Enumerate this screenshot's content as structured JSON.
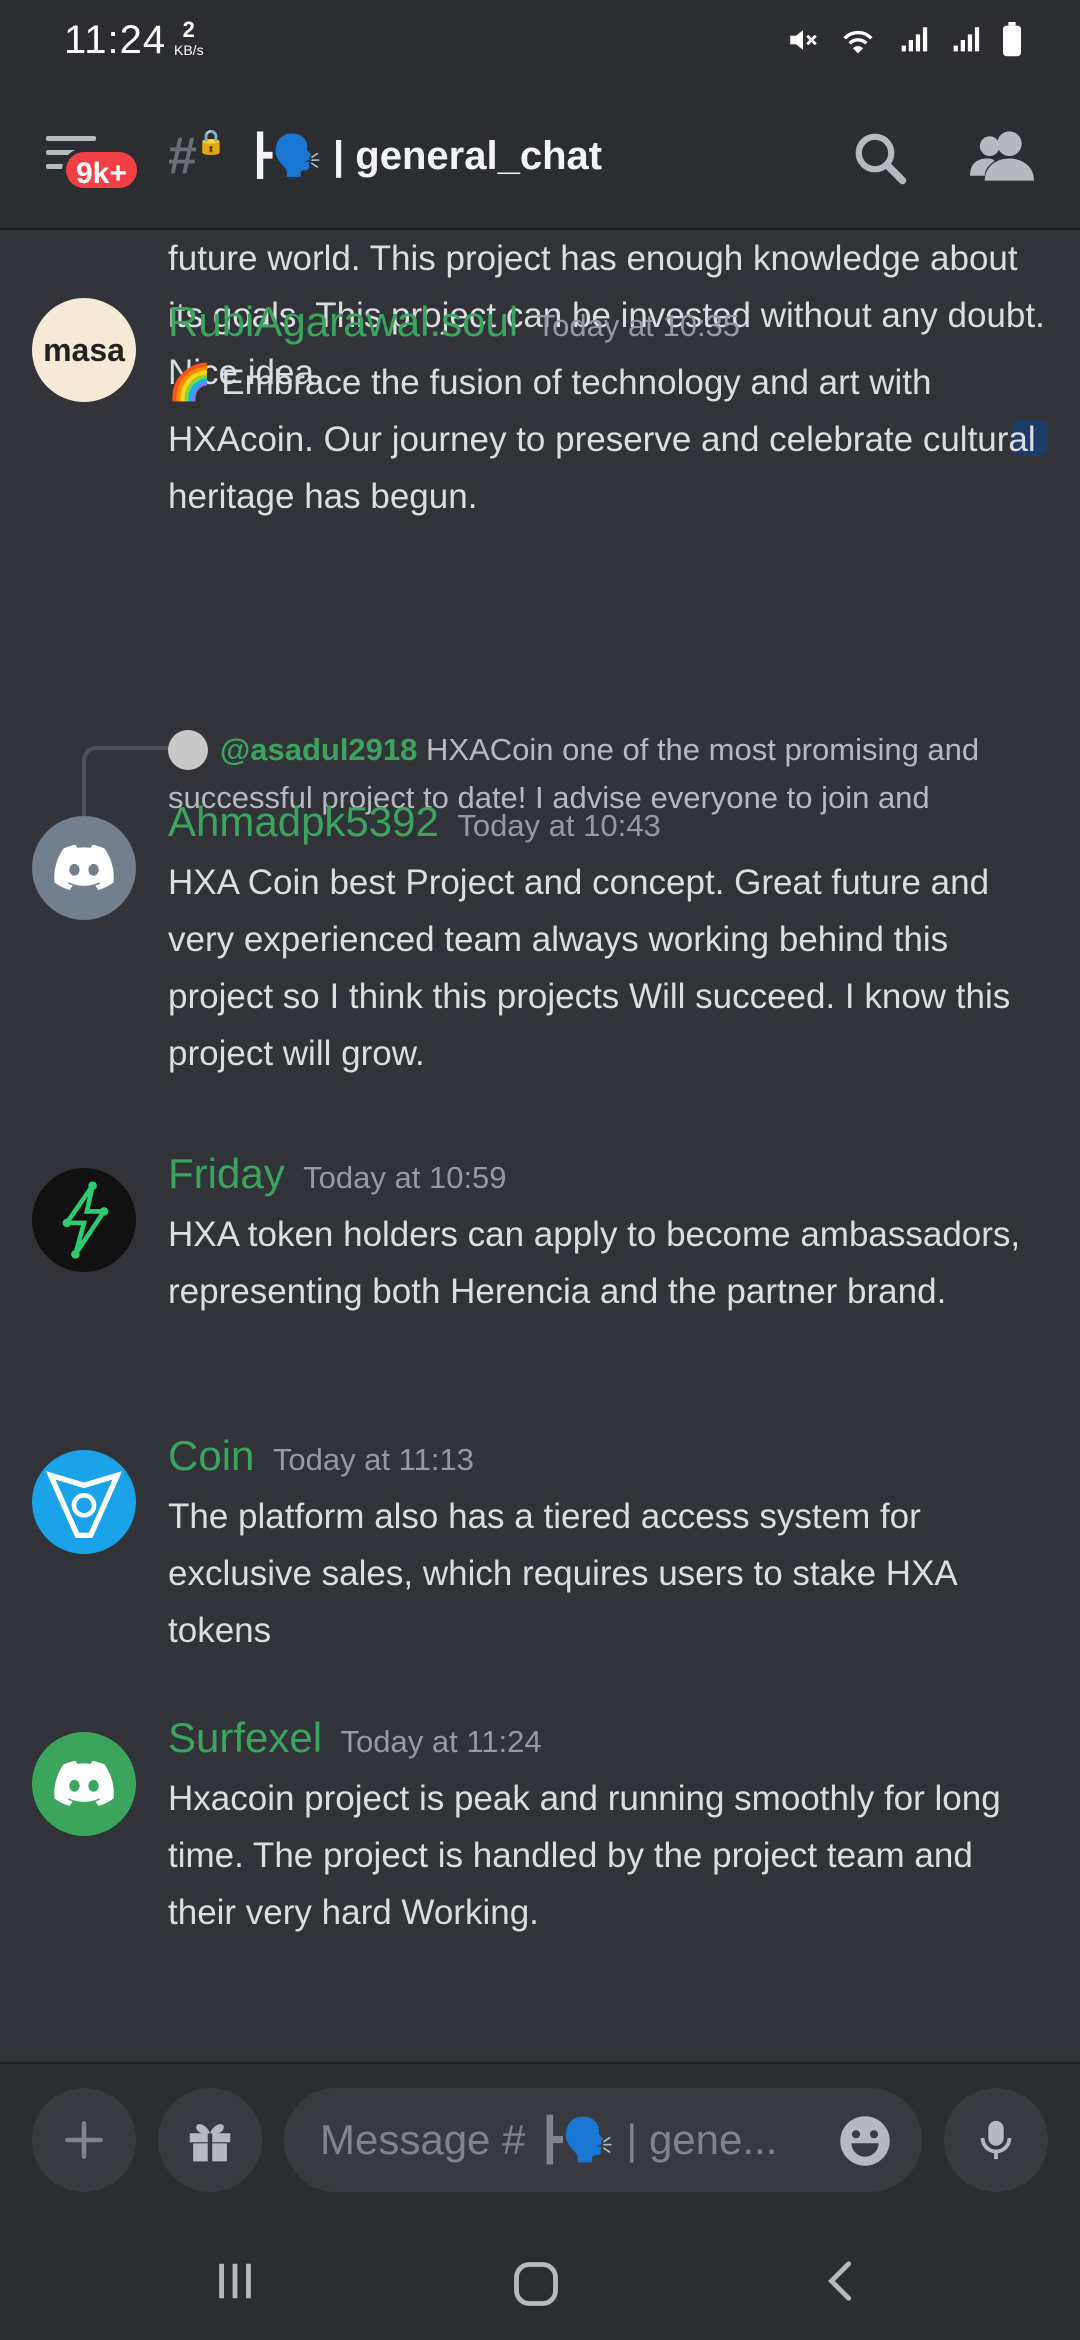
{
  "status_bar": {
    "time": "11:24",
    "speed_value": "2",
    "speed_unit": "KB/s"
  },
  "header": {
    "unread_badge": "9k+",
    "channel_title": "┣🗣️ | general_chat"
  },
  "messages": [
    {
      "text": "future world. This project has enough knowledge about its goals. This project can be invested without any doubt. Nice idea."
    },
    {
      "username": "RubiAgarawal.soul",
      "timestamp": "Today at 10:35",
      "avatar_text": "masa",
      "text": "🌈 Embrace the fusion of technology and art with HXAcoin. Our journey to preserve and celebrate cultural heritage has begun."
    },
    {
      "reply": {
        "mention": "@asadul2918",
        "text": "HXACoin one of the most promising and successful project to date! I advise     everyone to join and"
      },
      "username": "Ahmadpk5392",
      "timestamp": "Today at 10:43",
      "text": "HXA Coin best Project and concept. Great future and very experienced team always working behind this project so I think this projects Will succeed. I know this project will grow."
    },
    {
      "username": "Friday",
      "timestamp": "Today at 10:59",
      "text": "HXA token holders can apply to become ambassadors, representing both Herencia and the partner brand."
    },
    {
      "username": "Coin",
      "timestamp": "Today at 11:13",
      "text": "The platform also has a tiered access system for exclusive sales, which requires users to stake HXA tokens"
    },
    {
      "username": "Surfexel",
      "timestamp": "Today at 11:24",
      "text": "Hxacoin project is peak and running smoothly for long time. The project is handled by the project team and their very hard Working."
    }
  ],
  "input": {
    "placeholder": "Message # ┣🗣️ | gene..."
  },
  "colors": {
    "username": "#3ba55d",
    "background": "#313338",
    "badge": "#f23f43"
  },
  "icons": [
    "menu-icon",
    "search-icon",
    "members-icon",
    "plus-icon",
    "gift-icon",
    "emoji-icon",
    "mic-icon"
  ]
}
